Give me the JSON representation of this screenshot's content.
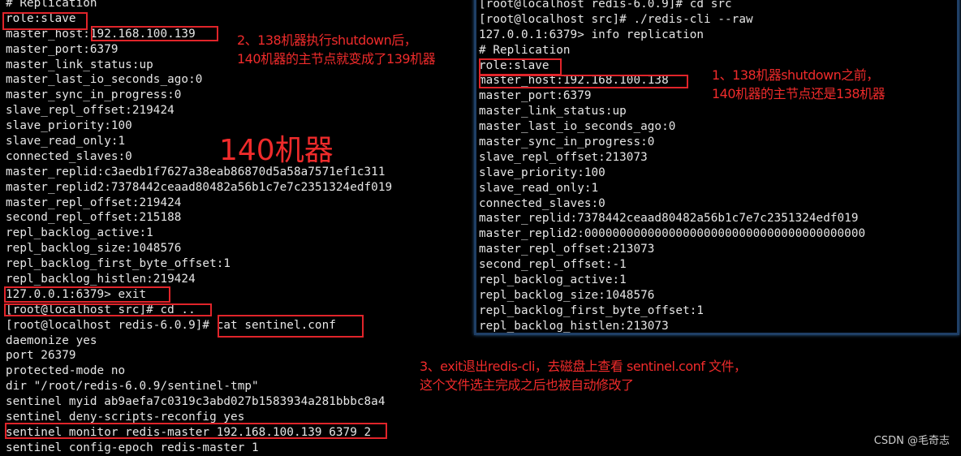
{
  "left_terminal": {
    "lines": [
      "# Replication",
      "role:slave",
      "master_host:192.168.100.139",
      "master_port:6379",
      "master_link_status:up",
      "master_last_io_seconds_ago:0",
      "master_sync_in_progress:0",
      "slave_repl_offset:219424",
      "slave_priority:100",
      "slave_read_only:1",
      "connected_slaves:0",
      "master_replid:c3aedb1f7627a38eab86870d5a58a7571ef1c311",
      "master_replid2:7378442ceaad80482a56b1c7e7c2351324edf019",
      "master_repl_offset:219424",
      "second_repl_offset:215188",
      "repl_backlog_active:1",
      "repl_backlog_size:1048576",
      "repl_backlog_first_byte_offset:1",
      "repl_backlog_histlen:219424",
      "127.0.0.1:6379> exit",
      "[root@localhost src]# cd ..",
      "[root@localhost redis-6.0.9]# cat sentinel.conf",
      "daemonize yes",
      "port 26379",
      "protected-mode no",
      "dir \"/root/redis-6.0.9/sentinel-tmp\"",
      "sentinel myid ab9aefa7c0319c3abd027b1583934a281bbbc8a4",
      "sentinel deny-scripts-reconfig yes",
      "sentinel monitor redis-master 192.168.100.139 6379 2",
      "sentinel config-epoch redis-master 1"
    ],
    "machine_label": "140机器"
  },
  "right_terminal": {
    "lines": [
      "[root@localhost redis-6.0.9]# cd src",
      "[root@localhost src]# ./redis-cli --raw",
      "127.0.0.1:6379> info replication",
      "# Replication",
      "role:slave",
      "master_host:192.168.100.138",
      "master_port:6379",
      "master_link_status:up",
      "master_last_io_seconds_ago:0",
      "master_sync_in_progress:0",
      "slave_repl_offset:213073",
      "slave_priority:100",
      "slave_read_only:1",
      "connected_slaves:0",
      "master_replid:7378442ceaad80482a56b1c7e7c2351324edf019",
      "master_replid2:0000000000000000000000000000000000000000",
      "master_repl_offset:213073",
      "second_repl_offset:-1",
      "repl_backlog_active:1",
      "repl_backlog_size:1048576",
      "repl_backlog_first_byte_offset:1",
      "repl_backlog_histlen:213073"
    ]
  },
  "annotations": {
    "note1": "1、138机器shutdown之前，\n140机器的主节点还是138机器",
    "note2": "2、138机器执行shutdown后，\n140机器的主节点就变成了139机器",
    "note3": "3、exit退出redis-cli，去磁盘上查看 sentinel.conf 文件，\n这个文件选主完成之后也被自动修改了"
  },
  "watermark": "CSDN @毛奇志",
  "colors": {
    "terminal_bg": "#000000",
    "terminal_text": "#e6e6e6",
    "highlight_red": "#e0242a",
    "window_border": "#1f3f66"
  }
}
